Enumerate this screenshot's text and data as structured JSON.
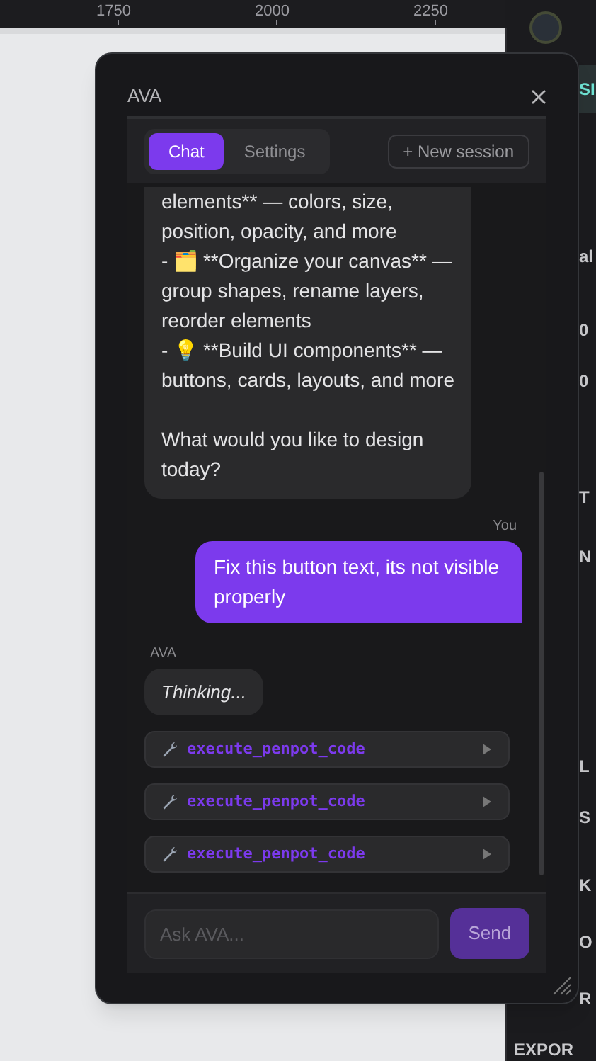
{
  "ruler": {
    "marks": [
      "1750",
      "2000",
      "2250"
    ]
  },
  "side_panel": {
    "fragments": [
      "SI",
      "al",
      "0",
      "0",
      "T",
      "N",
      "L",
      "S",
      "K",
      "O",
      "R",
      "EXPOR"
    ]
  },
  "chat_window": {
    "title": "AVA",
    "tabs": [
      {
        "label": "Chat",
        "selected": true
      },
      {
        "label": "Settings",
        "selected": false
      }
    ],
    "new_session_button": "+ New session",
    "messages": [
      {
        "kind": "assistant",
        "text": "elements** — colors, size, position, opacity, and more\n- 🗂️ **Organize your canvas** — group shapes, rename layers, reorder elements\n- 💡 **Build UI components** — buttons, cards, layouts, and more\n\nWhat would you like to design today?"
      },
      {
        "kind": "user",
        "sender": "You",
        "text": "Fix this button text, its not visible properly"
      },
      {
        "kind": "thinking",
        "sender": "AVA",
        "text": "Thinking..."
      },
      {
        "kind": "tool",
        "text": "execute_penpot_code",
        "expanded": false
      },
      {
        "kind": "tool",
        "text": "execute_penpot_code",
        "expanded": false
      },
      {
        "kind": "tool",
        "text": "execute_penpot_code",
        "expanded": false
      }
    ],
    "input": {
      "placeholder": "Ask AVA..."
    },
    "send_button": {
      "label": "Send",
      "disabled": true
    }
  }
}
